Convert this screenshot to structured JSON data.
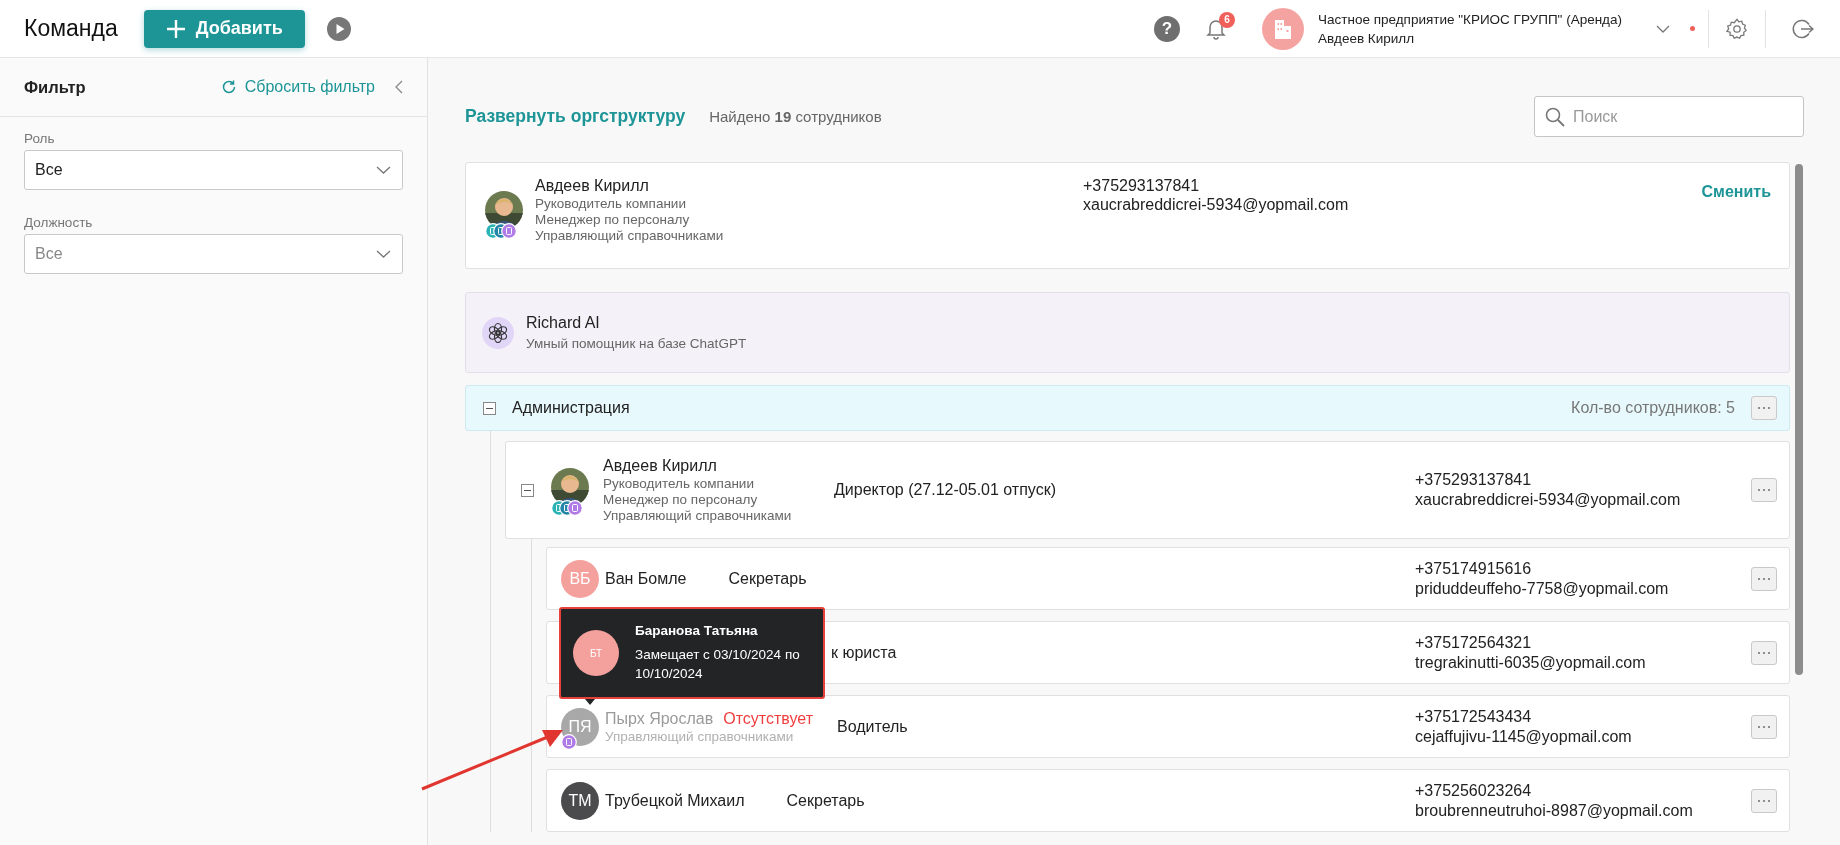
{
  "header": {
    "title": "Команда",
    "add_button": "Добавить",
    "help": "?",
    "notifications": "6",
    "company": "Частное предприятие \"КРИОС ГРУПП\" (Аренда)",
    "user": "Авдеев Кирилл"
  },
  "filter": {
    "title": "Фильтр",
    "reset": "Сбросить фильтр",
    "fields": [
      {
        "label": "Роль",
        "value": "Все"
      },
      {
        "label": "Должность",
        "placeholder": "Все"
      }
    ]
  },
  "toolbar": {
    "expand_link": "Развернуть оргструктуру",
    "found": "Найдено **19** сотрудников",
    "search": {
      "placeholder": "Поиск"
    }
  },
  "current_user": {
    "name": "Авдеев Кирилл",
    "roles": [
      "Руководитель компании",
      "Менеджер по персоналу",
      "Управляющий справочниками"
    ],
    "phone": "+375293137841",
    "email": "xaucrabreddicrei-5934@yopmail.com",
    "change_link": "Сменить"
  },
  "assistant": {
    "name": "Richard AI",
    "description": "Умный помощник на базе ChatGPT"
  },
  "department": {
    "name": "Администрация",
    "expanded": true,
    "count": "Кол-во сотрудников: 5",
    "head": {
      "name": "Авдеев Кирилл",
      "expanded": true,
      "roles": [
        "Руководитель компании",
        "Менеджер по персоналу",
        "Управляющий справочниками"
      ],
      "position": "Директор (27.12-05.01 отпуск)",
      "phone": "+375293137841",
      "email": "xaucrabreddicrei-5934@yopmail.com"
    },
    "members": [
      {
        "kind": "initials",
        "initials": "ВБ",
        "color": "#f4a19d",
        "name": "Ван Бомле",
        "absent": false,
        "position": "Секретарь",
        "phone": "+375174915616",
        "email": "priduddeuffeho-7758@yopmail.com"
      },
      {
        "kind": "covered",
        "position": "к юриста",
        "phone": "+375172564321",
        "email": "tregrakinutti-6035@yopmail.com"
      },
      {
        "kind": "initials",
        "initials": "ПЯ",
        "color": "#a8a8a8",
        "name": "Пырх Ярослав",
        "absent": true,
        "status": "Отсутствует",
        "roles": [
          "Управляющий справочниками"
        ],
        "position": "Водитель",
        "phone": "+375172543434",
        "email": "cejaffujivu-1145@yopmail.com"
      },
      {
        "kind": "initials",
        "initials": "ТМ",
        "color": "#4b4b4d",
        "name": "Трубецкой Михаил",
        "absent": false,
        "position": "Секретарь",
        "phone": "+375256023264",
        "email": "broubrenneutruhoi-8987@yopmail.com"
      }
    ]
  },
  "tooltip": {
    "initials": "БТ",
    "name": "Баранова Татьяна",
    "text": "Замещает с 03/10/2024 по 10/10/2024"
  }
}
